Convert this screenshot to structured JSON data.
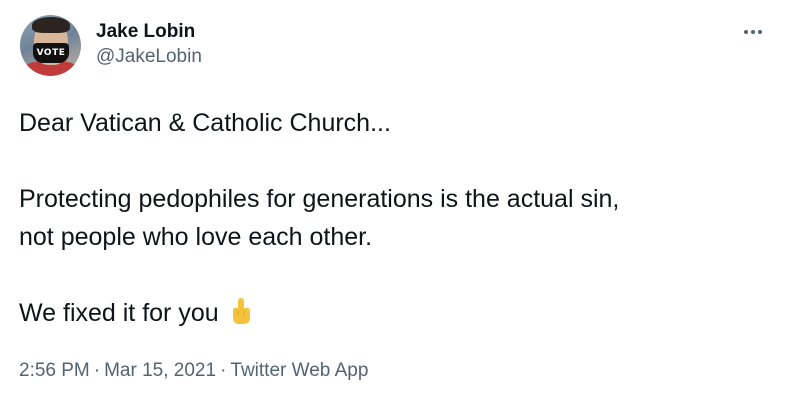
{
  "author": {
    "display_name": "Jake Lobin",
    "handle": "@JakeLobin",
    "avatar_mask_text": "VOTE"
  },
  "tweet": {
    "lines": [
      "Dear Vatican & Catholic Church...",
      "Protecting pedophiles for generations is the actual sin,",
      "not people who love each other.",
      "We fixed it for you"
    ],
    "emoji": "middle-finger-emoji"
  },
  "meta": {
    "time": "2:56 PM",
    "separator": "·",
    "date": "Mar 15, 2021",
    "source": "Twitter Web App"
  },
  "icons": {
    "more": "more-options-icon"
  },
  "colors": {
    "text": "#0f1419",
    "secondary": "#536471",
    "emoji_yellow": "#f5c33b"
  }
}
